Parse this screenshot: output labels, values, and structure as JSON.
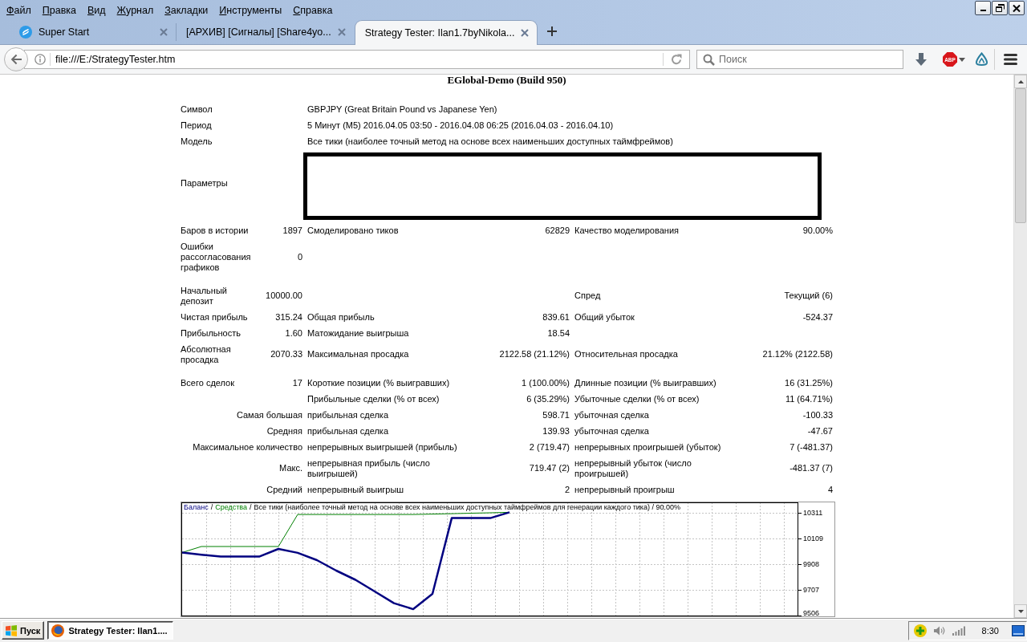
{
  "menu_bar": {
    "items": [
      "Файл",
      "Правка",
      "Вид",
      "Журнал",
      "Закладки",
      "Инструменты",
      "Справка"
    ]
  },
  "tabs": [
    {
      "title": "Super Start",
      "favicon": true,
      "selected": false
    },
    {
      "title": "[АРХИВ] [Сигналы] [Share4yo...",
      "favicon": false,
      "selected": false
    },
    {
      "title": "Strategy Tester: Ilan1.7byNikola...",
      "favicon": false,
      "selected": true
    }
  ],
  "nav_bar": {
    "url": "file:///E:/StrategyTester.htm",
    "search": {
      "placeholder": "Поиск"
    },
    "adblock_label": "ABP"
  },
  "report": {
    "server": "EGlobal-Demo (Build 950)",
    "sections": [
      [
        {
          "kind": "info",
          "label": "Символ",
          "value": "GBPJPY (Great Britain Pound vs Japanese Yen)"
        },
        {
          "kind": "info",
          "label": "Период",
          "value": "5 Минут (M5) 2016.04.05 03:50 - 2016.04.08 06:25 (2016.04.03 - 2016.04.10)"
        },
        {
          "kind": "info",
          "label": "Модель",
          "value": "Все тики (наиболее точный метод на основе всех наименьших доступных таймфреймов)"
        },
        {
          "kind": "params",
          "label": "Параметры"
        },
        {
          "kind": "stats",
          "cells": [
            {
              "label": "Баров в истории",
              "value": "1897"
            },
            {
              "label": "Смоделировано тиков",
              "value": "62829"
            },
            {
              "label": "Качество моделирования",
              "value": "90.00%"
            }
          ]
        },
        {
          "kind": "stats",
          "cells": [
            {
              "label": "Ошибки рассогласования графиков",
              "value": "0"
            }
          ]
        }
      ],
      [
        {
          "kind": "stats",
          "cells": [
            {
              "label": "Начальный депозит",
              "value": "10000.00"
            },
            null,
            {
              "label": "Спред",
              "value": "Текущий (6)"
            }
          ]
        },
        {
          "kind": "stats",
          "cells": [
            {
              "label": "Чистая прибыль",
              "value": "315.24"
            },
            {
              "label": "Общая прибыль",
              "value": "839.61"
            },
            {
              "label": "Общий убыток",
              "value": "-524.37"
            }
          ]
        },
        {
          "kind": "stats",
          "cells": [
            {
              "label": "Прибыльность",
              "value": "1.60"
            },
            {
              "label": "Матожидание выигрыша",
              "value": "18.54"
            }
          ]
        },
        {
          "kind": "stats",
          "cells": [
            {
              "label": "Абсолютная просадка",
              "value": "2070.33"
            },
            {
              "label": "Максимальная просадка",
              "value": "2122.58 (21.12%)"
            },
            {
              "label": "Относительная просадка",
              "value": "21.12% (2122.58)"
            }
          ]
        }
      ],
      [
        {
          "kind": "stats",
          "cells": [
            {
              "label": "Всего сделок",
              "value": "17"
            },
            {
              "label": "Короткие позиции (% выигравших)",
              "value": "1 (100.00%)"
            },
            {
              "label": "Длинные позиции (% выигравших)",
              "value": "16 (31.25%)"
            }
          ]
        },
        {
          "kind": "stats",
          "cells": [
            null,
            {
              "label": "Прибыльные сделки (% от всех)",
              "value": "6 (35.29%)"
            },
            {
              "label": "Убыточные сделки (% от всех)",
              "value": "11 (64.71%)"
            }
          ]
        },
        {
          "kind": "detail",
          "heading": "Самая большая",
          "cells": [
            {
              "label": "прибыльная сделка",
              "value": "598.71"
            },
            {
              "label": "убыточная сделка",
              "value": "-100.33"
            }
          ]
        },
        {
          "kind": "detail",
          "heading": "Средняя",
          "cells": [
            {
              "label": "прибыльная сделка",
              "value": "139.93"
            },
            {
              "label": "убыточная сделка",
              "value": "-47.67"
            }
          ]
        },
        {
          "kind": "detail",
          "heading": "Максимальное количество",
          "cells": [
            {
              "label": "непрерывных выигрышей (прибыль)",
              "value": "2 (719.47)"
            },
            {
              "label": "непрерывных проигрышей (убыток)",
              "value": "7 (-481.37)"
            }
          ]
        },
        {
          "kind": "detail",
          "heading": "Макс.",
          "cells": [
            {
              "label": "непрерывная прибыль (число выигрышей)",
              "value": "719.47 (2)"
            },
            {
              "label": "непрерывный убыток (число проигрышей)",
              "value": "-481.37 (7)"
            }
          ]
        },
        {
          "kind": "detail",
          "heading": "Средний",
          "cells": [
            {
              "label": "непрерывный выигрыш",
              "value": "2"
            },
            {
              "label": "непрерывный проигрыш",
              "value": "4"
            }
          ]
        }
      ]
    ],
    "chart_data": {
      "type": "line",
      "title": "Все тики (наиболее точный метод на основе всех наименьших доступных таймфреймов для генерации каждого тика) / 90.00%",
      "annotations": [
        "/",
        "/"
      ],
      "series": [
        {
          "name": "Баланс",
          "color": "#000080",
          "values": [
            10000,
            9983,
            9968,
            9968,
            9968,
            10028,
            9997,
            9940,
            9858,
            9786,
            9695,
            9603,
            9556,
            9676,
            10270,
            10270,
            10270,
            10315
          ]
        },
        {
          "name": "Средства",
          "color": "#008000",
          "values": [
            10000,
            10047,
            10047,
            10047,
            10047,
            10047,
            10298,
            10298,
            10298,
            10298,
            10298,
            10298,
            10298,
            10301,
            10304,
            10308,
            10311,
            10315
          ]
        }
      ],
      "ylim": [
        9506,
        10393
      ],
      "yticks": [
        9506,
        9707,
        9908,
        10109,
        10311
      ],
      "grid": true
    }
  },
  "taskbar": {
    "start_label": "Пуск",
    "tasks": [
      {
        "label": "Strategy Tester: Ilan1....",
        "selected": true
      }
    ],
    "clock": "8:30"
  }
}
